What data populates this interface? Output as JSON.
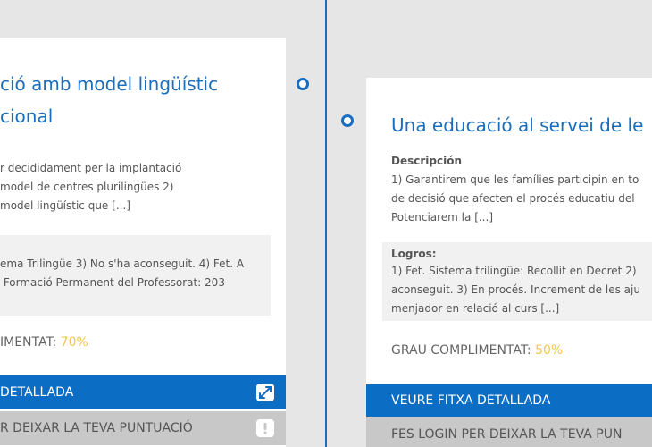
{
  "cards": {
    "left": {
      "title_line1": "ció amb model lingüístic",
      "title_line2": "cional",
      "description_text": "r decididament per la implantació\nmodel de centres plurilingües 2)\nmodel lingüístic que [...]",
      "goals_text": "ema Trilingüe 3) No s'ha aconseguit. 4) Fet. A\n Formació Permanent del Professorat: 203",
      "grau_label": "IMENTAT:",
      "grau_value": "70%",
      "detail_button_label": "DETALLADA",
      "rate_button_label": "R DEIXAR LA TEVA PUNTUACIÓ"
    },
    "right": {
      "title": "Una educació al servei de le",
      "description_label": "Descripción",
      "description_text": "1) Garantirem que les famílies participin en to\nde decisió que afecten el procés educatiu del\nPotenciarem la [...]",
      "goals_label": "Logros:",
      "goals_text": "1) Fet. Sistema trilingüe: Recollit en Decret 2)\naconseguit. 3) En procés. Increment de les aju\nmenjador en relació al curs [...]",
      "grau_label": "GRAU COMPLIMENTAT:",
      "grau_value": "50%",
      "detail_button_label": "VEURE FITXA DETALLADA",
      "rate_button_label": "FES LOGIN PER DEIXAR LA TEVA PUN"
    }
  },
  "colors": {
    "accent": "#1a6ebd",
    "button_blue": "#0b6dc3",
    "percent": "#f6c744",
    "button_grey": "#c8c8c8"
  },
  "icons": {
    "detail": "expand-icon",
    "rate": "exclamation-icon",
    "timeline": "timeline-dot-icon"
  }
}
